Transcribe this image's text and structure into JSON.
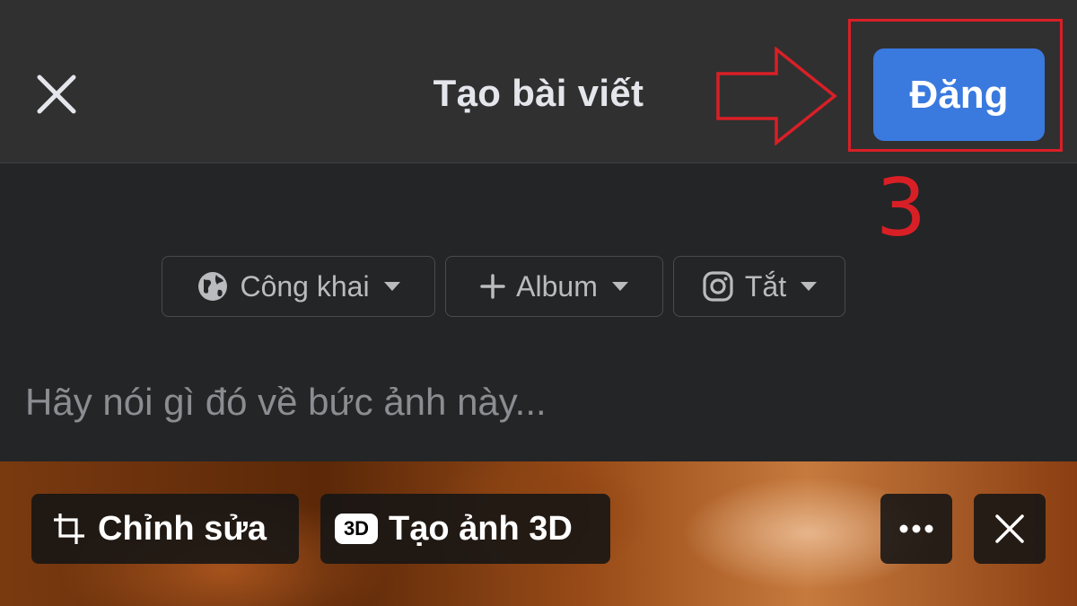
{
  "header": {
    "title": "Tạo bài viết",
    "post_label": "Đăng",
    "close_icon": "close-icon"
  },
  "annotation": {
    "step_number": "3",
    "color": "#d91f26"
  },
  "chips": [
    {
      "icon": "globe-icon",
      "label": "Công khai"
    },
    {
      "icon": "plus-icon",
      "label": "Album"
    },
    {
      "icon": "instagram-icon",
      "label": "Tắt"
    }
  ],
  "caption": {
    "placeholder": "Hãy nói gì đó về bức ảnh này..."
  },
  "photo_toolbar": {
    "edit_label": "Chỉnh sửa",
    "create3d_label": "Tạo ảnh 3D",
    "badge_3d": "3D",
    "more_icon": "more-icon",
    "remove_icon": "close-icon"
  },
  "colors": {
    "accent": "#3a79de",
    "background": "#242526",
    "header": "#303031"
  }
}
